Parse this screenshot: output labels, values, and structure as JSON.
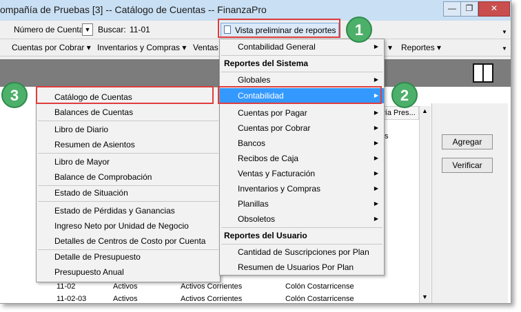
{
  "window": {
    "title": "ompañía de Pruebas [3] -- Catálogo de Cuentas -- FinanzaPro",
    "controls": {
      "minimize": "—",
      "restore": "❐",
      "close": "✕"
    }
  },
  "toolbar": {
    "filter_field": "Número de Cuenta",
    "search_label": "Buscar:",
    "search_value": "11-01",
    "preview_button": "Vista preliminar de reportes"
  },
  "menubar": {
    "items": [
      "Cuentas por Cobrar ▾",
      "Inventarios y Compras ▾",
      "Ventas",
      "▾",
      "Reportes ▾"
    ]
  },
  "right_panel": {
    "add_button": "Agregar",
    "verify_button": "Verificar"
  },
  "grid": {
    "header_partial": "oría Pres...",
    "side_text": "s",
    "rows": [
      {
        "code": "11-02",
        "type": "Activos",
        "group": "Activos Corrientes",
        "currency": "Colón Costarricense"
      },
      {
        "code": "11-02-03",
        "type": "Activos",
        "group": "Activos Corrientes",
        "currency": "Colón Costarricense"
      }
    ]
  },
  "reports_menu": {
    "items": [
      {
        "label": "Contabilidad General",
        "kind": "item",
        "arrow": true
      },
      {
        "label": "Reportes del Sistema",
        "kind": "section"
      },
      {
        "label": "Globales",
        "kind": "item",
        "arrow": true
      },
      {
        "label": "Contabilidad",
        "kind": "item",
        "arrow": true,
        "highlighted": true
      },
      {
        "label": "Cuentas por Pagar",
        "kind": "item",
        "arrow": true
      },
      {
        "label": "Cuentas por Cobrar",
        "kind": "item",
        "arrow": true
      },
      {
        "label": "Bancos",
        "kind": "item",
        "arrow": true
      },
      {
        "label": "Recibos de Caja",
        "kind": "item",
        "arrow": true
      },
      {
        "label": "Ventas y Facturación",
        "kind": "item",
        "arrow": true
      },
      {
        "label": "Inventarios y Compras",
        "kind": "item",
        "arrow": true
      },
      {
        "label": "Planillas",
        "kind": "item",
        "arrow": true
      },
      {
        "label": "Obsoletos",
        "kind": "item",
        "arrow": true
      },
      {
        "label": "Reportes del Usuario",
        "kind": "section"
      },
      {
        "label": "Cantidad de Suscripciones por Plan",
        "kind": "item"
      },
      {
        "label": "Resumen de Usuarios Por Plan",
        "kind": "item"
      }
    ]
  },
  "contabilidad_submenu": {
    "items": [
      "Catálogo de Cuentas",
      "Balances de Cuentas",
      "Libro de Diario",
      "Resumen de Asientos",
      "Libro de Mayor",
      "Balance de Comprobación",
      "Estado de Situación",
      "Estado de Pérdidas y Ganancias",
      "Ingreso Neto por Unidad de Negocio",
      "Detalles de Centros de Costo por Cuenta",
      "Detalle de Presupuesto",
      "Presupuesto Anual"
    ]
  },
  "callouts": [
    "1",
    "2",
    "3"
  ],
  "colors": {
    "highlight": "#3399ff",
    "annotation_red": "#e03c3c",
    "callout_green": "#4db06a",
    "banner": "#7c7c7c"
  }
}
